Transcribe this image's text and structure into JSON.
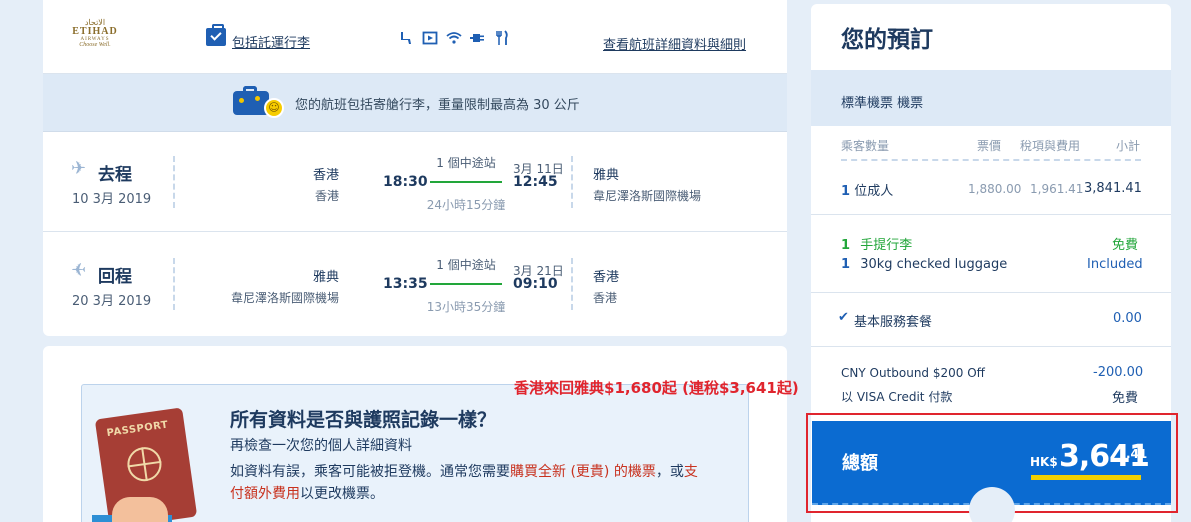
{
  "flight": {
    "airline_logo": {
      "arabic": "الاتحاد",
      "name": "ETIHAD",
      "sub": "AIRWAYS",
      "tagline": "Choose Well."
    },
    "baggage_included_link": "包括託運行李",
    "details_link": "查看航班詳細資料與細則",
    "amenity_icons": [
      "seat-icon",
      "screen-icon",
      "wifi-icon",
      "power-icon",
      "meal-icon"
    ],
    "baggage_notice": "您的航班包括寄艙行李，重量限制最高為 30 公斤",
    "outbound": {
      "title": "去程",
      "date": "10 3月 2019",
      "from_city": "香港",
      "from_airport": "香港",
      "depart_time": "18:30",
      "stops": "1 個中途站",
      "duration": "24小時15分鐘",
      "arrive_date": "3月 11日",
      "arrive_time": "12:45",
      "to_city": "雅典",
      "to_airport": "韋尼澤洛斯國際機場"
    },
    "return": {
      "title": "回程",
      "date": "20 3月 2019",
      "from_city": "雅典",
      "from_airport": "韋尼澤洛斯國際機場",
      "depart_time": "13:35",
      "stops": "1 個中途站",
      "duration": "13小時35分鐘",
      "arrive_date": "3月 21日",
      "arrive_time": "09:10",
      "to_city": "香港",
      "to_airport": "香港"
    }
  },
  "passport_check": {
    "passport_label": "PASSPORT",
    "title": "所有資料是否與護照記錄一樣？",
    "subtitle": "再檢查一次您的個人詳細資料",
    "body_before": "如資料有誤，乘客可能被拒登機。通常您需要",
    "body_red1": "購買全新 (更貴) 的機票",
    "body_mid": "，或",
    "body_red2": "支付額外費用",
    "body_after": "以更改機票。"
  },
  "promo_banner": "香港來回雅典$1,680起 (連稅$3,641起)",
  "summary": {
    "title": "您的預訂",
    "ticket_type": "標準機票 機票",
    "headers": {
      "passengers": "乘客數量",
      "fare": "票價",
      "taxes": "稅項與費用",
      "subtotal": "小計"
    },
    "adult_count": "1",
    "adult_label": "位成人",
    "fare": "1,880.00",
    "taxes": "1,961.41",
    "subtotal": "3,841.41",
    "hand_luggage_count": "1",
    "hand_luggage_label": "手提行李",
    "hand_luggage_price": "免費",
    "checked_count": "1",
    "checked_label": "30kg checked luggage",
    "checked_price": "Included",
    "service_label": "基本服務套餐",
    "service_price": "0.00",
    "discount_label": "CNY Outbound $200 Off",
    "discount_value": "-200.00",
    "payment_label": "以 VISA Credit 付款",
    "payment_value": "免費",
    "total_label": "總額",
    "total_currency": "HK$",
    "total_amount": "3,641",
    "total_cents": ".41"
  }
}
